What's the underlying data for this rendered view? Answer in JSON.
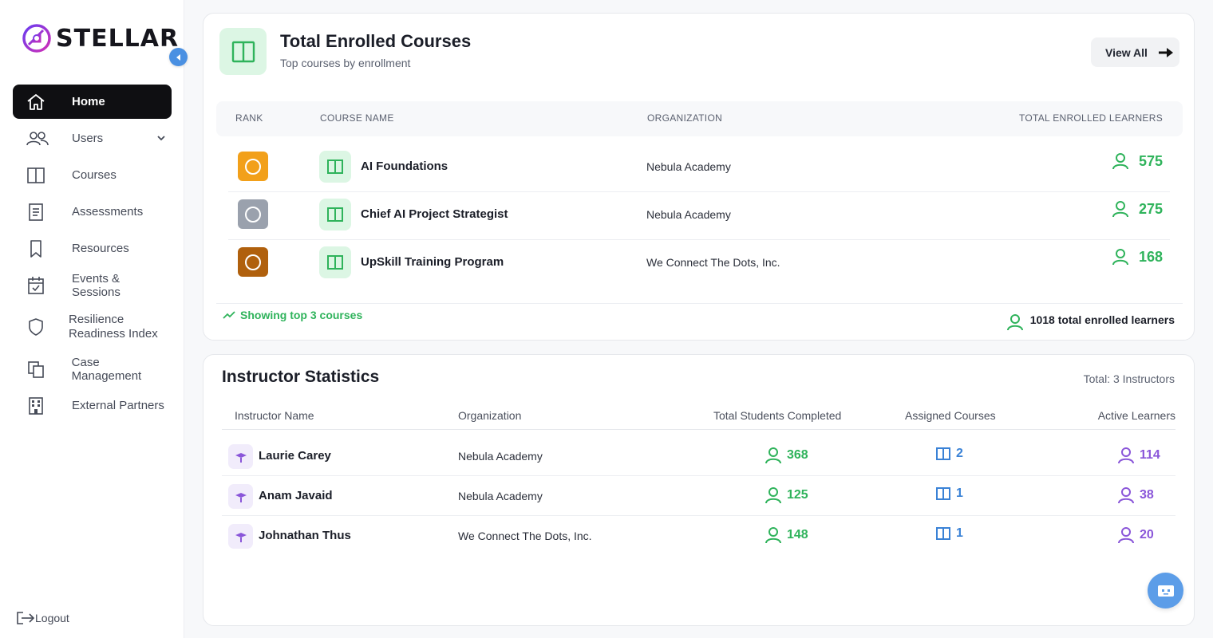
{
  "app": {
    "logo_text": "STELLAR"
  },
  "sidebar": {
    "items": [
      {
        "label": "Home",
        "icon": "home-icon",
        "active": true
      },
      {
        "label": "Users",
        "icon": "users-icon",
        "has_submenu": true
      },
      {
        "label": "Courses",
        "icon": "book-icon"
      },
      {
        "label": "Assessments",
        "icon": "document-icon"
      },
      {
        "label": "Resources",
        "icon": "bookmark-icon"
      },
      {
        "label": "Events & Sessions",
        "icon": "calendar-icon"
      },
      {
        "label": "Resilience Readiness Index",
        "icon": "shield-icon"
      },
      {
        "label": "Case Management",
        "icon": "copy-icon"
      },
      {
        "label": "External Partners",
        "icon": "building-icon"
      }
    ],
    "logout_label": "Logout"
  },
  "courses_card": {
    "title": "Total Enrolled Courses",
    "subtitle": "Top courses by enrollment",
    "view_all_label": "View All",
    "columns": [
      "RANK",
      "COURSE NAME",
      "ORGANIZATION",
      "TOTAL ENROLLED LEARNERS"
    ],
    "rows": [
      {
        "rank_color": "#f2a01a",
        "name": "AI Foundations",
        "organization": "Nebula Academy",
        "learners": "575"
      },
      {
        "rank_color": "#9aa1ad",
        "name": "Chief AI Project Strategist",
        "organization": "Nebula Academy",
        "learners": "275"
      },
      {
        "rank_color": "#b0600d",
        "name": "UpSkill Training Program",
        "organization": "We Connect The Dots, Inc.",
        "learners": "168"
      }
    ],
    "footer_left": "Showing top 3 courses",
    "footer_right": "1018 total enrolled learners"
  },
  "instructors_card": {
    "title": "Instructor Statistics",
    "total_label": "Total: 3 Instructors",
    "columns": [
      "Instructor Name",
      "Organization",
      "Total Students Completed",
      "Assigned Courses",
      "Active Learners"
    ],
    "rows": [
      {
        "name": "Laurie Carey",
        "organization": "Nebula Academy",
        "completed": "368",
        "assigned": "2",
        "active": "114"
      },
      {
        "name": "Anam Javaid",
        "organization": "Nebula Academy",
        "completed": "125",
        "assigned": "1",
        "active": "38"
      },
      {
        "name": "Johnathan Thus",
        "organization": "We Connect The Dots, Inc.",
        "completed": "148",
        "assigned": "1",
        "active": "20"
      }
    ]
  },
  "colors": {
    "accent_green": "#2fb35b",
    "accent_blue": "#3a82d6",
    "accent_purple": "#8a56d9",
    "nav_active": "#0f0f12"
  }
}
